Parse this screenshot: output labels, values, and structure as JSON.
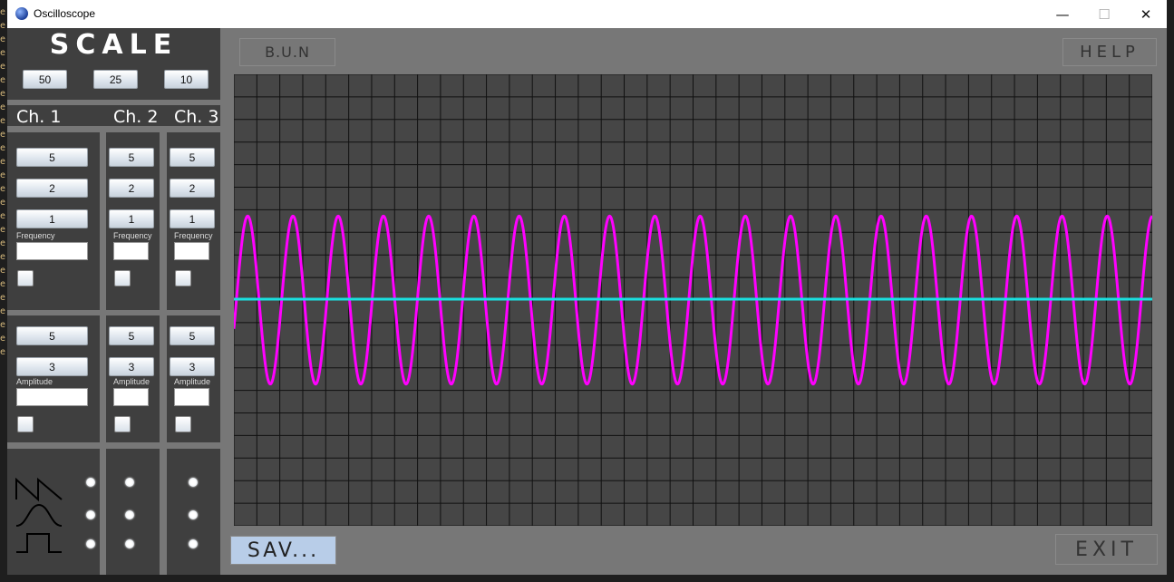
{
  "window": {
    "title": "Oscilloscope",
    "min_glyph": "—",
    "max_glyph": "☐",
    "close_glyph": "✕"
  },
  "left_panel": {
    "scale_title": "SCALE",
    "scale_buttons": [
      "50",
      "25",
      "10"
    ],
    "channels": [
      "Ch. 1",
      "Ch. 2",
      "Ch. 3"
    ],
    "frequency": {
      "buttons": [
        "5",
        "2",
        "1"
      ],
      "label": "Frequency"
    },
    "amplitude": {
      "buttons": [
        "5",
        "3"
      ],
      "label": "Amplitude"
    },
    "waveform_icons": [
      "sawtooth-icon",
      "sine-icon",
      "square-icon"
    ]
  },
  "top_bar": {
    "bun_label": "B.U.N",
    "help_label": "HELP"
  },
  "bottom_bar": {
    "save_label": "SAV...",
    "exit_label": "EXIT"
  },
  "colors": {
    "panel_bg": "#777777",
    "dark": "#3f3f3f",
    "scope_bg": "#464646",
    "grid": "#111111",
    "ch1_trace": "#ff00ff",
    "ch2_trace": "#19e0e0"
  },
  "chart_data": {
    "type": "line",
    "grid": true,
    "series": [
      {
        "color": "#ff00ff",
        "shape": "sine",
        "cycles": 20.3,
        "amplitude_divisions": 3,
        "offset_divisions": 0
      },
      {
        "color": "#19e0e0",
        "shape": "flat",
        "value": 0
      }
    ],
    "divisions_x": 40,
    "divisions_y": 20
  }
}
